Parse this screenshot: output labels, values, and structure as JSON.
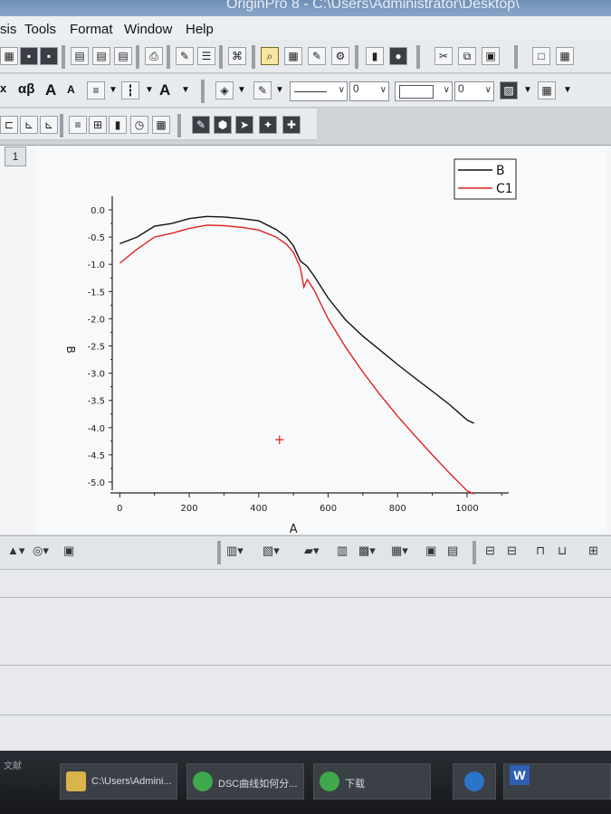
{
  "window": {
    "title": "OriginPro 8 - C:\\Users\\Administrator\\Desktop\\"
  },
  "menu": [
    "sis",
    "Tools",
    "Format",
    "Window",
    "Help"
  ],
  "format_bar": {
    "greek_label": "αβ",
    "line_width_value": "0",
    "pattern_value": "0"
  },
  "graph": {
    "window_number": "1",
    "legend": [
      "B",
      "C1"
    ]
  },
  "chart_data": {
    "type": "line",
    "xlabel": "A",
    "ylabel": "B",
    "xlim": [
      -100,
      1120
    ],
    "ylim": [
      -5.2,
      0.25
    ],
    "xticks": [
      0,
      200,
      400,
      600,
      800,
      1000
    ],
    "yticks": [
      0.0,
      -0.5,
      -1.0,
      -1.5,
      -2.0,
      -2.5,
      -3.0,
      -3.5,
      -4.0,
      -4.5,
      -5.0
    ],
    "xtick_labels": [
      "0",
      "200",
      "400",
      "600",
      "800",
      "1000"
    ],
    "ytick_labels": [
      "0.0",
      "-0.5",
      "-1.0",
      "-1.5",
      "-2.0",
      "-2.5",
      "-3.0",
      "-3.5",
      "-4.0",
      "-4.5",
      "-5.0"
    ],
    "series": [
      {
        "name": "B",
        "color": "#111111",
        "x": [
          0,
          50,
          100,
          150,
          200,
          250,
          300,
          350,
          400,
          450,
          480,
          500,
          520,
          540,
          560,
          600,
          650,
          700,
          750,
          800,
          850,
          900,
          950,
          1000,
          1020
        ],
        "y": [
          -0.62,
          -0.5,
          -0.3,
          -0.25,
          -0.16,
          -0.12,
          -0.13,
          -0.16,
          -0.2,
          -0.36,
          -0.5,
          -0.66,
          -0.94,
          -1.04,
          -1.22,
          -1.62,
          -2.02,
          -2.32,
          -2.58,
          -2.84,
          -3.09,
          -3.33,
          -3.58,
          -3.86,
          -3.92
        ]
      },
      {
        "name": "C1",
        "color": "#e02020",
        "x": [
          0,
          50,
          100,
          150,
          200,
          250,
          300,
          350,
          400,
          450,
          480,
          500,
          520,
          530,
          540,
          560,
          600,
          650,
          700,
          750,
          800,
          850,
          900,
          950,
          1000,
          1020
        ],
        "y": [
          -0.98,
          -0.72,
          -0.5,
          -0.43,
          -0.34,
          -0.28,
          -0.29,
          -0.32,
          -0.37,
          -0.5,
          -0.63,
          -0.78,
          -1.06,
          -1.42,
          -1.28,
          -1.48,
          -2.0,
          -2.52,
          -2.98,
          -3.4,
          -3.79,
          -4.15,
          -4.5,
          -4.84,
          -5.16,
          -5.22
        ]
      }
    ],
    "marker": {
      "symbol": "+",
      "x": 460,
      "y": -4.22,
      "color": "#e02020"
    }
  },
  "bottom_toolbar": {},
  "taskbar": {
    "items": [
      {
        "label": "C:\\Users\\Admini..."
      },
      {
        "label": "DSC曲线如何分..."
      },
      {
        "label": "下载"
      }
    ],
    "word_label": "W",
    "left_text": "文献"
  }
}
